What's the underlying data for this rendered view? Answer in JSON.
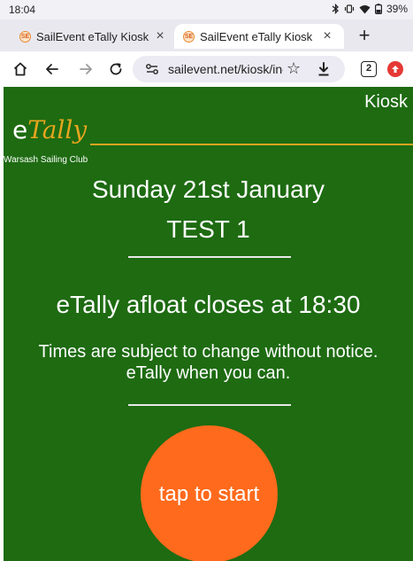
{
  "status_bar": {
    "time": "18:04",
    "battery": "39%"
  },
  "tabs": [
    {
      "favicon": "SE",
      "title": "SailEvent eTally Kiosk",
      "close": "×",
      "active": false
    },
    {
      "favicon": "SE",
      "title": "SailEvent eTally Kiosk",
      "close": "×",
      "active": true
    }
  ],
  "new_tab_label": "+",
  "address_bar": {
    "url": "sailevent.net/kiosk/inc",
    "tab_count": "2"
  },
  "page": {
    "logo_e": "e",
    "logo_tally": "Tally",
    "kiosk_label": "Kiosk",
    "club_name": "Warsash Sailing Club",
    "date": "Sunday 21st January",
    "event": "TEST 1",
    "closes": "eTally afloat closes at 18:30",
    "notice_line1": "Times are subject to change without notice.",
    "notice_line2": "eTally when you can.",
    "start_button": "tap to start"
  },
  "colors": {
    "page_bg": "#1e6b12",
    "logo_accent": "#e6a41e",
    "start_button": "#ff6a1c"
  }
}
